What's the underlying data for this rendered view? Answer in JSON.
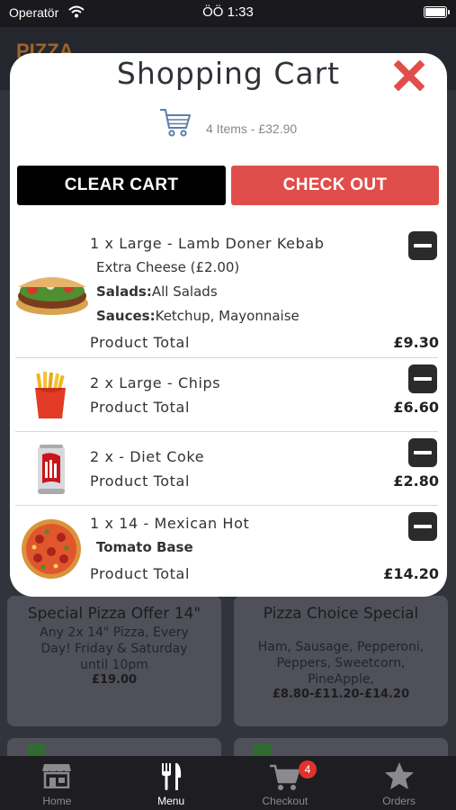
{
  "status_bar": {
    "carrier": "Operatör",
    "time": "ÖÖ 1:33"
  },
  "background": {
    "logo": "PIZZA",
    "cards": [
      {
        "title": "Special Pizza Offer 14\"",
        "desc": "Any 2x 14\" Pizza, Every Day! Friday & Saturday until 10pm",
        "price": "£19.00"
      },
      {
        "title": "Pizza Choice Special",
        "desc": "Ham, Sausage, Pepperoni, Peppers, Sweetcorn, PineApple,",
        "price": "£8.80-£11.20-£14.20"
      }
    ]
  },
  "modal": {
    "title": "Shopping Cart",
    "summary": "4 Items - £32.90",
    "clear_label": "CLEAR CART",
    "checkout_label": "CHECK OUT",
    "items": [
      {
        "name": "1 x Large - Lamb Doner Kebab",
        "extra": "Extra Cheese (£2.00)",
        "salads_label": "Salads:",
        "salads": "All Salads",
        "sauces_label": "Sauces:",
        "sauces": "Ketchup, Mayonnaise",
        "total_label": "Product Total",
        "total": "£9.30",
        "image": "kebab"
      },
      {
        "name": "2 x Large - Chips",
        "total_label": "Product Total",
        "total": "£6.60",
        "image": "chips"
      },
      {
        "name": "2 x - Diet Coke",
        "total_label": "Product Total",
        "total": "£2.80",
        "image": "diet-coke"
      },
      {
        "name": "1 x 14 - Mexican Hot",
        "base": "Tomato Base",
        "total_label": "Product Total",
        "total": "£14.20",
        "image": "pizza"
      }
    ]
  },
  "tabs": [
    {
      "label": "Home",
      "icon": "store-icon"
    },
    {
      "label": "Menu",
      "icon": "fork-knife-icon"
    },
    {
      "label": "Checkout",
      "icon": "cart-icon",
      "badge": "4"
    },
    {
      "label": "Orders",
      "icon": "star-icon"
    }
  ],
  "colors": {
    "accent": "#e04e4b",
    "close": "#e04e4b",
    "clear": "#000000"
  }
}
